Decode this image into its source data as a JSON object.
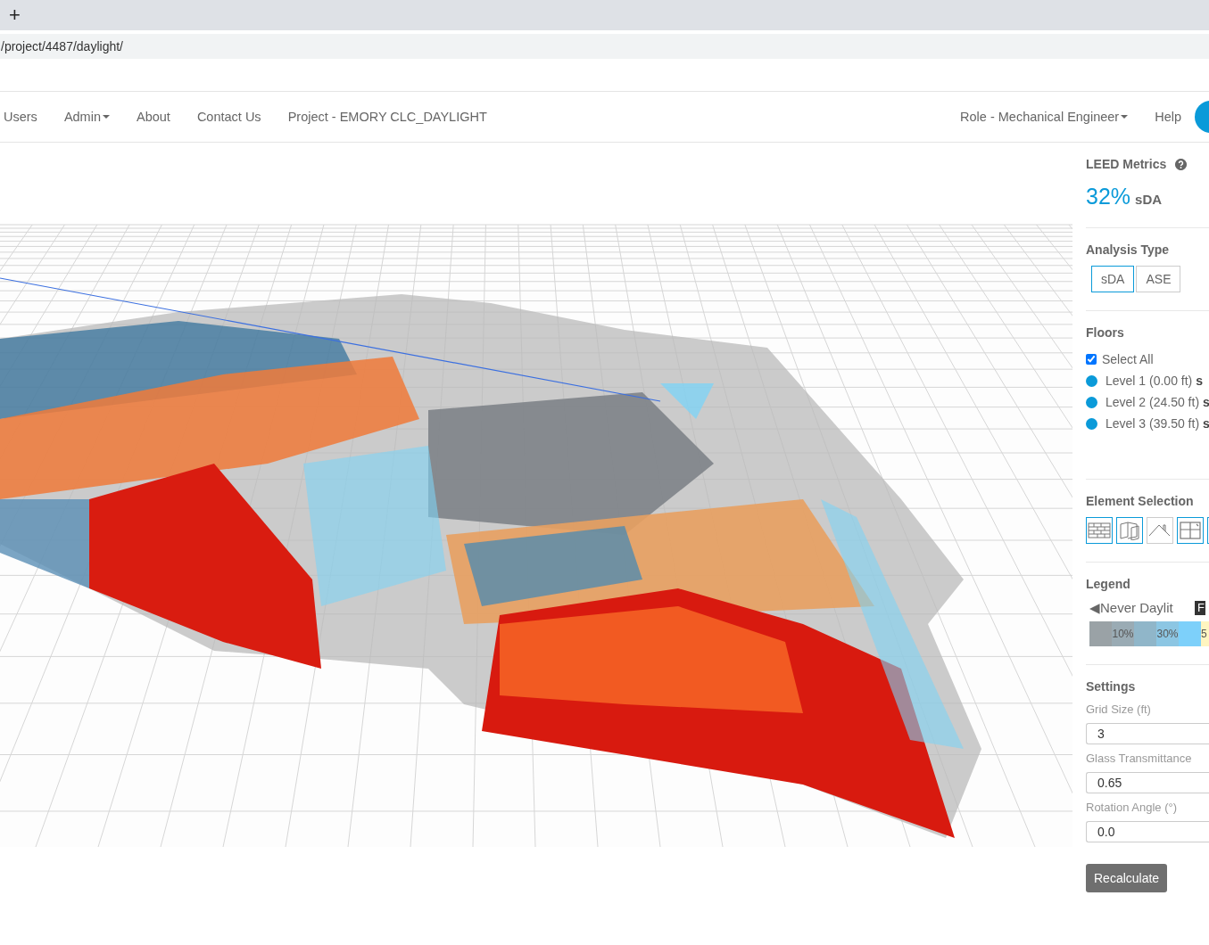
{
  "browser": {
    "new_tab_label": "+",
    "url": "/project/4487/daylight/"
  },
  "nav": {
    "left_items": [
      {
        "label": "Users",
        "dropdown": false
      },
      {
        "label": "Admin",
        "dropdown": true
      },
      {
        "label": "About",
        "dropdown": false
      },
      {
        "label": "Contact Us",
        "dropdown": false
      },
      {
        "label": "Project - EMORY CLC_DAYLIGHT",
        "dropdown": false
      }
    ],
    "right_items": [
      {
        "label": "Role - Mechanical Engineer",
        "dropdown": true
      },
      {
        "label": "Help",
        "dropdown": false
      }
    ]
  },
  "panel": {
    "leed_metrics": {
      "title": "LEED Metrics",
      "value": "32%",
      "unit": "sDA"
    },
    "analysis_type": {
      "title": "Analysis Type",
      "options": [
        {
          "label": "sDA",
          "selected": true
        },
        {
          "label": "ASE",
          "selected": false
        }
      ]
    },
    "floors": {
      "title": "Floors",
      "select_all": {
        "label": "Select All",
        "checked": true
      },
      "items": [
        {
          "label": "Level 1 (0.00 ft) **s**",
          "color": "#0a9ad9"
        },
        {
          "label": "Level 2 (24.50 ft) **s**",
          "color": "#0a9ad9"
        },
        {
          "label": "Level 3 (39.50 ft) **s**",
          "color": "#0a9ad9"
        }
      ]
    },
    "element_selection": {
      "title": "Element Selection",
      "items": [
        {
          "kind": "wall",
          "selected": true
        },
        {
          "kind": "door",
          "selected": true
        },
        {
          "kind": "roof",
          "selected": false
        },
        {
          "kind": "window",
          "selected": true
        },
        {
          "kind": "other",
          "selected": true
        }
      ]
    },
    "legend": {
      "title": "Legend",
      "arrow": "◀",
      "start_label": "Never Daylit",
      "cut_label": "F",
      "segments": [
        {
          "color": "#9aa2a6"
        },
        {
          "label": "10%",
          "color": "#9aabb4"
        },
        {
          "color": "#90b6c9"
        },
        {
          "label": "30%",
          "color": "#8cc6e3"
        },
        {
          "color": "#7dd0fa"
        },
        {
          "label": "5",
          "color": "#fff5c0"
        }
      ]
    },
    "settings": {
      "title": "Settings",
      "fields": [
        {
          "label": "Grid Size (ft)",
          "value": "3"
        },
        {
          "label": "Glass Transmittance",
          "value": "0.65"
        },
        {
          "label": "Rotation Angle (°)",
          "value": "0.0"
        }
      ],
      "button": "Recalculate"
    }
  }
}
